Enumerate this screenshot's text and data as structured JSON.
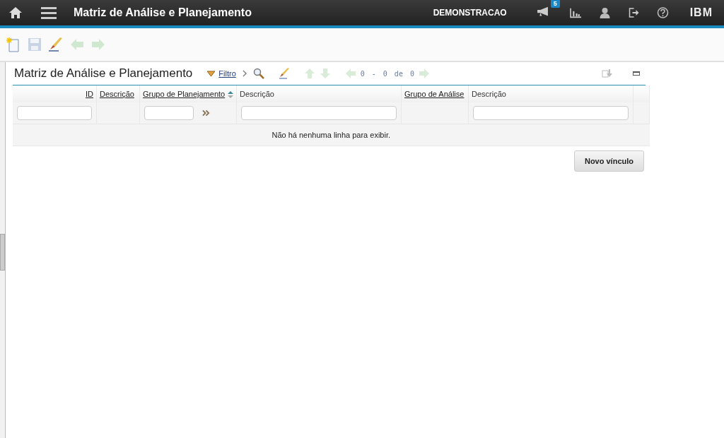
{
  "header": {
    "title": "Matriz de Análise e Planejamento",
    "user": "DEMONSTRACAO",
    "notifications": "5",
    "logo": "IBM"
  },
  "section": {
    "title": "Matriz de Análise e Planejamento",
    "filter": "Filtro",
    "pager": [
      "0",
      "-",
      "0",
      "de",
      "0"
    ]
  },
  "table": {
    "columns": [
      {
        "label": "ID",
        "kind": "numeric",
        "link": true,
        "sorted": false,
        "filter": {
          "kind": "field"
        }
      },
      {
        "label": "Descrição",
        "kind": "text",
        "link": true,
        "sorted": false,
        "filter": {
          "kind": "none"
        }
      },
      {
        "label": "Grupo de Planejamento",
        "kind": "text",
        "link": true,
        "sorted": true,
        "filter": {
          "kind": "field-more"
        }
      },
      {
        "label": "Descrição",
        "kind": "text",
        "link": false,
        "sorted": false,
        "filter": {
          "kind": "field"
        }
      },
      {
        "label": "Grupo de Análise",
        "kind": "text",
        "link": true,
        "sorted": false,
        "filter": {
          "kind": "none"
        }
      },
      {
        "label": "Descrição",
        "kind": "text",
        "link": false,
        "sorted": false,
        "filter": {
          "kind": "field"
        }
      }
    ],
    "empty": "Não há nenhuma linha para exibir."
  },
  "buttons": [
    "Novo vínculo"
  ]
}
